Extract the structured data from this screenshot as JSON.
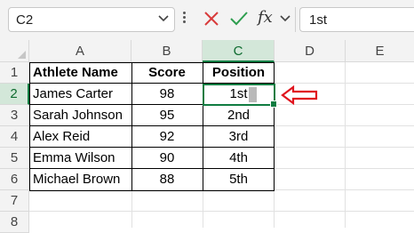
{
  "formula_bar": {
    "name_box": "C2",
    "formula": "1st",
    "fx_label": "fx"
  },
  "columns": [
    "A",
    "B",
    "C",
    "D",
    "E"
  ],
  "rows": [
    "1",
    "2",
    "3",
    "4",
    "5",
    "6",
    "7",
    "8"
  ],
  "table": {
    "headers": [
      "Athlete Name",
      "Score",
      "Position"
    ],
    "rows": [
      [
        "James Carter",
        "98",
        "1st"
      ],
      [
        "Sarah Johnson",
        "95",
        "2nd"
      ],
      [
        "Alex Reid",
        "92",
        "3rd"
      ],
      [
        "Emma Wilson",
        "90",
        "4th"
      ],
      [
        "Michael Brown",
        "88",
        "5th"
      ]
    ]
  },
  "colors": {
    "accent": "#107c41",
    "annotation_arrow": "#e0141e"
  },
  "icons": {
    "cancel": "close-icon",
    "enter": "check-icon",
    "annotation": "left-arrow-icon"
  }
}
